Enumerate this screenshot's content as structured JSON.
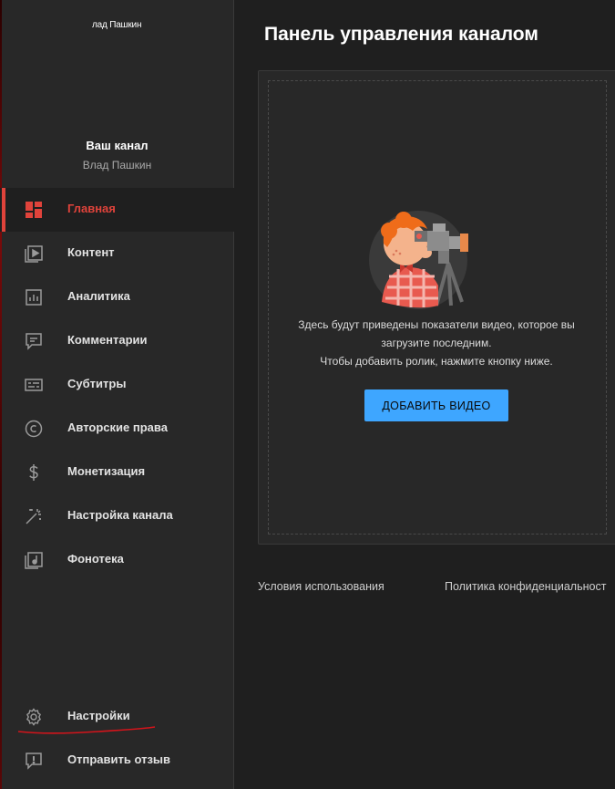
{
  "sidebar": {
    "avatar_text": "лад Пашкин",
    "channel_title": "Ваш канал",
    "channel_name": "Влад Пашкин",
    "items": [
      {
        "label": "Главная",
        "icon": "dashboard-icon",
        "active": true
      },
      {
        "label": "Контент",
        "icon": "content-icon"
      },
      {
        "label": "Аналитика",
        "icon": "analytics-icon"
      },
      {
        "label": "Комментарии",
        "icon": "comments-icon"
      },
      {
        "label": "Субтитры",
        "icon": "subtitles-icon"
      },
      {
        "label": "Авторские права",
        "icon": "copyright-icon"
      },
      {
        "label": "Монетизация",
        "icon": "monetization-icon"
      },
      {
        "label": "Настройка канала",
        "icon": "customization-icon"
      },
      {
        "label": "Фонотека",
        "icon": "audio-library-icon"
      }
    ],
    "bottom_items": [
      {
        "label": "Настройки",
        "icon": "gear-icon"
      },
      {
        "label": "Отправить отзыв",
        "icon": "feedback-icon"
      }
    ]
  },
  "main": {
    "title": "Панель управления каналом",
    "empty_state": {
      "line1": "Здесь будут приведены показатели видео, которое вы",
      "line2": "загрузите последним.",
      "line3": "Чтобы добавить ролик, нажмите кнопку ниже."
    },
    "upload_button": "ДОБАВИТЬ ВИДЕО",
    "footer": {
      "terms": "Условия использования",
      "privacy": "Политика конфиденциальност"
    }
  },
  "colors": {
    "accent_red": "#e0433b",
    "button_blue": "#3ea6ff",
    "sidebar_bg": "#282828",
    "main_bg": "#1f1f1f"
  }
}
